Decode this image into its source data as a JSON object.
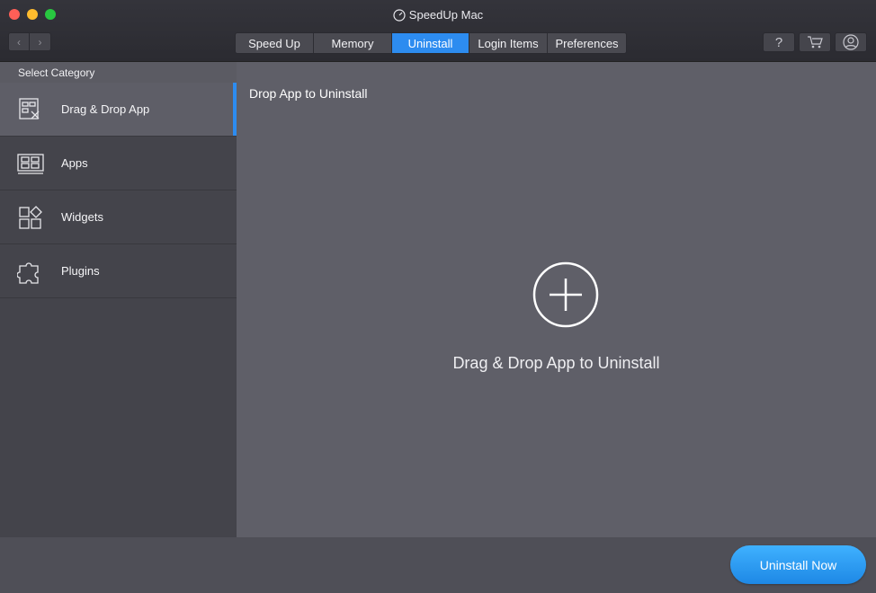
{
  "window": {
    "title": "SpeedUp Mac"
  },
  "nav": {
    "back_label": "‹",
    "forward_label": "›"
  },
  "tabs": [
    {
      "label": "Speed Up",
      "active": false
    },
    {
      "label": "Memory",
      "active": false
    },
    {
      "label": "Uninstall",
      "active": true
    },
    {
      "label": "Login Items",
      "active": false
    },
    {
      "label": "Preferences",
      "active": false
    }
  ],
  "toolbar": {
    "help_label": "?",
    "cart_icon": "cart-icon",
    "account_icon": "account-icon"
  },
  "sidebar": {
    "header": "Select Category",
    "items": [
      {
        "label": "Drag & Drop App",
        "icon": "drag-drop-icon",
        "active": true
      },
      {
        "label": "Apps",
        "icon": "apps-icon",
        "active": false
      },
      {
        "label": "Widgets",
        "icon": "widgets-icon",
        "active": false
      },
      {
        "label": "Plugins",
        "icon": "plugins-icon",
        "active": false
      }
    ]
  },
  "main": {
    "title": "Drop App to Uninstall",
    "drop_text": "Drag & Drop App to Uninstall",
    "drop_icon": "add-circle-icon"
  },
  "footer": {
    "uninstall_label": "Uninstall Now"
  },
  "colors": {
    "accent": "#2d8cf0",
    "button": "#1e88e5"
  }
}
